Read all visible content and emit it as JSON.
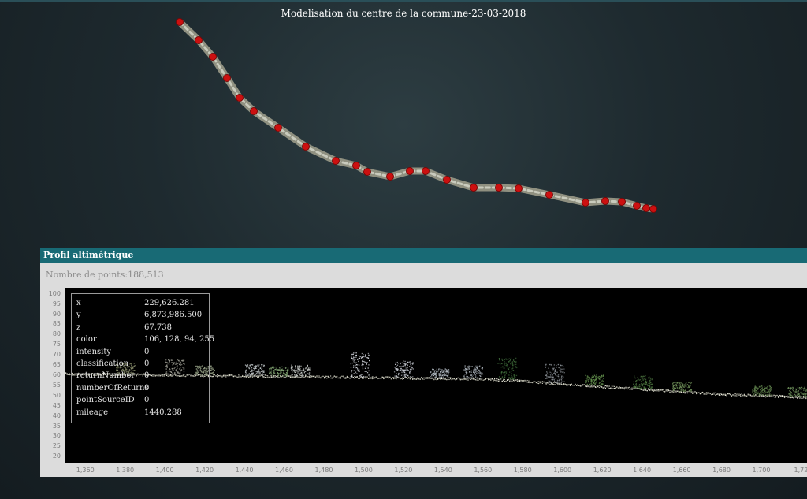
{
  "scene": {
    "title": "Modelisation du centre de la commune-23-03-2018"
  },
  "profile_panel": {
    "title": "Profil altimétrique",
    "points_label": "Nombre de points:",
    "points_value": "188,513"
  },
  "chart_data": {
    "type": "scatter",
    "title": "",
    "xlabel": "",
    "ylabel": "",
    "x_ticks": [
      "1,360",
      "1,380",
      "1,400",
      "1,420",
      "1,440",
      "1,460",
      "1,480",
      "1,500",
      "1,520",
      "1,540",
      "1,560",
      "1,580",
      "1,600",
      "1,620",
      "1,640",
      "1,660",
      "1,680",
      "1,700",
      "1,72"
    ],
    "y_ticks": [
      "100",
      "95",
      "90",
      "85",
      "80",
      "75",
      "70",
      "65",
      "60",
      "55",
      "50",
      "45",
      "40",
      "35",
      "30",
      "25",
      "20"
    ],
    "xlim": [
      1350,
      1723
    ],
    "ylim": [
      17,
      103
    ],
    "ground_profile": {
      "x": [
        1350,
        1400,
        1440,
        1480,
        1520,
        1560,
        1580,
        1600,
        1640,
        1680,
        1723
      ],
      "z": [
        61,
        60.5,
        60,
        59.5,
        59,
        58.5,
        57.5,
        56,
        53.5,
        51,
        49.5
      ]
    },
    "grid": false,
    "legend": "none"
  },
  "point_info": {
    "rows": [
      {
        "key": "x",
        "value": "229,626.281"
      },
      {
        "key": "y",
        "value": "6,873,986.500"
      },
      {
        "key": "z",
        "value": "67.738"
      },
      {
        "key": "color",
        "value": "106, 128, 94, 255"
      },
      {
        "key": "intensity",
        "value": "0"
      },
      {
        "key": "classification",
        "value": "0"
      },
      {
        "key": "returnNumber",
        "value": "0"
      },
      {
        "key": "numberOfReturns",
        "value": "0"
      },
      {
        "key": "pointSourceID",
        "value": "0"
      },
      {
        "key": "mileage",
        "value": "1440.288"
      }
    ]
  },
  "colors": {
    "panel_header": "#186a75",
    "marker": "#cc1010",
    "plot_bg": "#000000"
  }
}
